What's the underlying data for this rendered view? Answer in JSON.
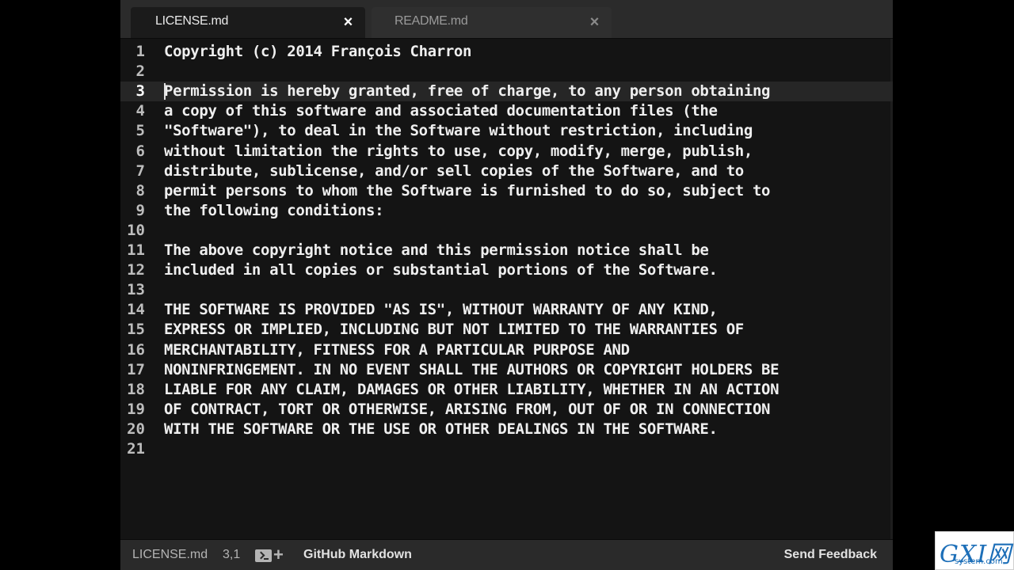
{
  "tabs": [
    {
      "label": "LICENSE.md",
      "close": "×",
      "active": true
    },
    {
      "label": "README.md",
      "close": "×",
      "active": false
    }
  ],
  "editor": {
    "current_line": 3,
    "lines": [
      {
        "num": "1",
        "text": "Copyright (c) 2014 François Charron"
      },
      {
        "num": "2",
        "text": ""
      },
      {
        "num": "3",
        "text": "Permission is hereby granted, free of charge, to any person obtaining"
      },
      {
        "num": "4",
        "text": "a copy of this software and associated documentation files (the"
      },
      {
        "num": "5",
        "text": "\"Software\"), to deal in the Software without restriction, including"
      },
      {
        "num": "6",
        "text": "without limitation the rights to use, copy, modify, merge, publish,"
      },
      {
        "num": "7",
        "text": "distribute, sublicense, and/or sell copies of the Software, and to"
      },
      {
        "num": "8",
        "text": "permit persons to whom the Software is furnished to do so, subject to"
      },
      {
        "num": "9",
        "text": "the following conditions:"
      },
      {
        "num": "10",
        "text": ""
      },
      {
        "num": "11",
        "text": "The above copyright notice and this permission notice shall be"
      },
      {
        "num": "12",
        "text": "included in all copies or substantial portions of the Software."
      },
      {
        "num": "13",
        "text": ""
      },
      {
        "num": "14",
        "text": "THE SOFTWARE IS PROVIDED \"AS IS\", WITHOUT WARRANTY OF ANY KIND,"
      },
      {
        "num": "15",
        "text": "EXPRESS OR IMPLIED, INCLUDING BUT NOT LIMITED TO THE WARRANTIES OF"
      },
      {
        "num": "16",
        "text": "MERCHANTABILITY, FITNESS FOR A PARTICULAR PURPOSE AND"
      },
      {
        "num": "17",
        "text": "NONINFRINGEMENT. IN NO EVENT SHALL THE AUTHORS OR COPYRIGHT HOLDERS BE"
      },
      {
        "num": "18",
        "text": "LIABLE FOR ANY CLAIM, DAMAGES OR OTHER LIABILITY, WHETHER IN AN ACTION"
      },
      {
        "num": "19",
        "text": "OF CONTRACT, TORT OR OTHERWISE, ARISING FROM, OUT OF OR IN CONNECTION"
      },
      {
        "num": "20",
        "text": "WITH THE SOFTWARE OR THE USE OR OTHER DEALINGS IN THE SOFTWARE."
      },
      {
        "num": "21",
        "text": ""
      }
    ]
  },
  "statusbar": {
    "file": "LICENSE.md",
    "cursor": "3,1",
    "terminal_icon": "terminal-icon",
    "plus": "+",
    "grammar": "GitHub Markdown",
    "feedback": "Send Feedback"
  },
  "watermark": {
    "main": "GXI网",
    "sub": "system.com"
  },
  "colors": {
    "editor_bg": "#141414",
    "tabbar_bg": "#2b2b2b",
    "text": "#efefef",
    "current_line_bg": "#262626"
  }
}
